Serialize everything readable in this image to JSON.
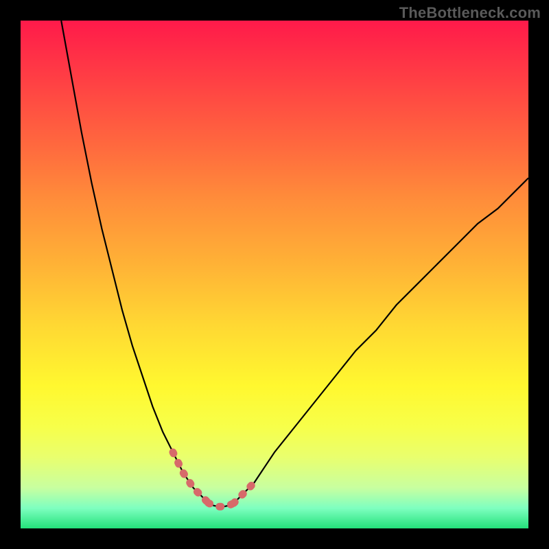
{
  "watermark": "TheBottleneck.com",
  "colors": {
    "background": "#000000",
    "curve_stroke": "#000000",
    "marker_stroke": "#d76a6a"
  },
  "chart_data": {
    "type": "line",
    "title": "",
    "xlabel": "",
    "ylabel": "",
    "xlim": [
      0,
      100
    ],
    "ylim": [
      0,
      100
    ],
    "annotations": [],
    "series": [
      {
        "name": "bottleneck-curve-left",
        "x": [
          8,
          10,
          12,
          14,
          16,
          18,
          20,
          22,
          24,
          26,
          28,
          30,
          32,
          34,
          36,
          37
        ],
        "y": [
          100,
          89,
          78,
          68,
          59,
          51,
          43,
          36,
          30,
          24,
          19,
          15,
          11,
          8,
          6,
          5
        ]
      },
      {
        "name": "bottleneck-curve-right",
        "x": [
          42,
          44,
          46,
          48,
          50,
          54,
          58,
          62,
          66,
          70,
          74,
          78,
          82,
          86,
          90,
          94,
          98,
          100
        ],
        "y": [
          5,
          7,
          9,
          12,
          15,
          20,
          25,
          30,
          35,
          39,
          44,
          48,
          52,
          56,
          60,
          63,
          67,
          69
        ]
      },
      {
        "name": "bottleneck-floor",
        "x": [
          37,
          38,
          39,
          40,
          41,
          42
        ],
        "y": [
          5,
          4.5,
          4.3,
          4.3,
          4.5,
          5
        ]
      },
      {
        "name": "highlight-markers-left",
        "x": [
          30,
          31,
          32,
          33,
          34,
          35,
          36,
          37
        ],
        "y": [
          15,
          13,
          11,
          9.5,
          8,
          7,
          6,
          5
        ]
      },
      {
        "name": "highlight-markers-floor",
        "x": [
          37,
          38,
          39,
          40,
          41,
          42
        ],
        "y": [
          5,
          4.5,
          4.3,
          4.3,
          4.5,
          5
        ]
      },
      {
        "name": "highlight-markers-right",
        "x": [
          42,
          43,
          44,
          45,
          46
        ],
        "y": [
          5,
          6,
          7,
          8,
          9
        ]
      }
    ]
  }
}
